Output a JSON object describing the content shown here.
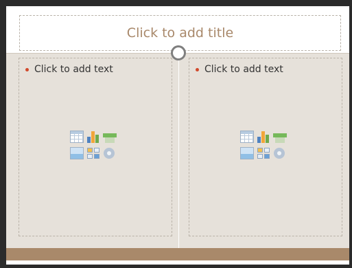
{
  "title_placeholder": "Click to add title",
  "content_placeholders": [
    {
      "bullet_text": "Click to add text"
    },
    {
      "bullet_text": "Click to add text"
    }
  ],
  "icons": [
    "insert-table-icon",
    "insert-chart-icon",
    "insert-smartart-icon",
    "insert-picture-icon",
    "insert-clipart-icon",
    "insert-media-icon"
  ],
  "colors": {
    "title_text": "#a8886a",
    "slide_background": "#e6e1da",
    "footer_bar": "#a9896a",
    "bullet": "#d1492b"
  }
}
